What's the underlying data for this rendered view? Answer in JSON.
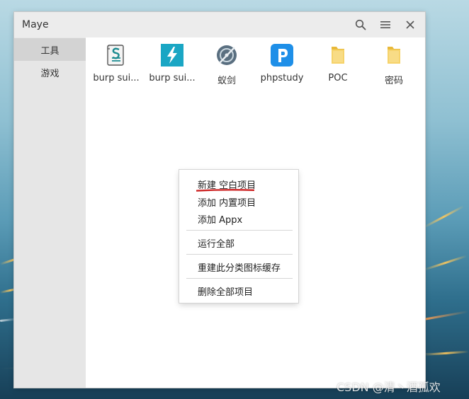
{
  "window": {
    "title": "Maye"
  },
  "titlebar": {
    "search_icon": "search-icon",
    "menu_icon": "hamburger-menu-icon",
    "close_icon": "close-icon"
  },
  "sidebar": {
    "items": [
      {
        "label": "工具",
        "active": true
      },
      {
        "label": "游戏",
        "active": false
      }
    ]
  },
  "apps": [
    {
      "label": "burp sui...",
      "icon": "burp-suite-script-icon"
    },
    {
      "label": "burp sui...",
      "icon": "burp-suite-lightning-icon"
    },
    {
      "label": "蚁剑",
      "icon": "antsword-icon"
    },
    {
      "label": "phpstudy",
      "icon": "phpstudy-icon"
    },
    {
      "label": "POC",
      "icon": "folder-icon"
    },
    {
      "label": "密码",
      "icon": "folder-icon"
    }
  ],
  "context_menu": {
    "items": [
      "新建 空白项目",
      "添加 内置项目",
      "添加 Appx",
      "运行全部",
      "重建此分类图标缓存",
      "删除全部项目"
    ],
    "highlight_color": "#cc1f1f"
  },
  "watermark": "CSDN @清丶酒孤欢",
  "colors": {
    "titlebar": "#ececec",
    "sidebar": "#e6e6e6",
    "sidebar_active": "#d3d3d3",
    "phpstudy_blue": "#1e8fe8",
    "burp_cyan": "#1aa6c4",
    "folder_yellow": "#f3c94f"
  }
}
